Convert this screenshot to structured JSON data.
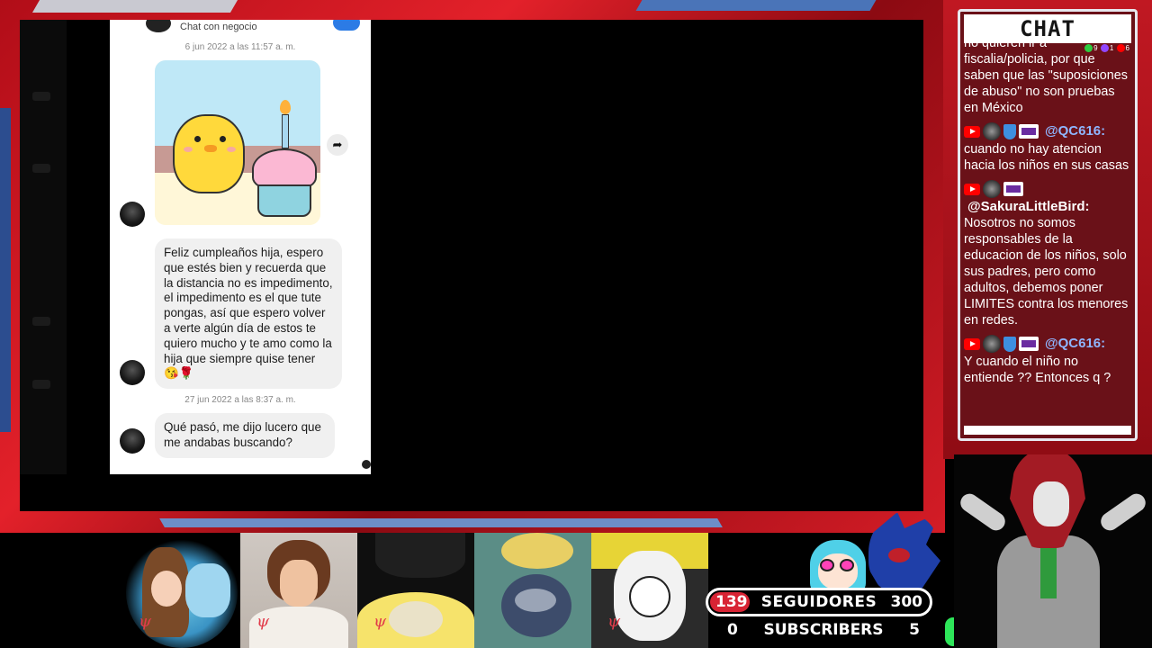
{
  "phone_chat": {
    "header_subtitle": "Chat con negocio",
    "timestamp_1": "6 jun 2022 a las 11:57 a. m.",
    "message_1": "Feliz cumpleaños hija, espero que estés bien y recuerda que la distancia no es impedimento, el impedimento es el que tute pongas, así que espero volver a verte algún día de estos te quiero mucho y te amo como la hija que siempre quise tener 😘🌹",
    "timestamp_2": "27 jun 2022 a las 8:37 a. m.",
    "message_2": "Qué pasó, me dijo lucero que me andabas buscando?",
    "share_icon": "share-arrow-icon"
  },
  "chat_panel": {
    "title": "CHAT",
    "stats": {
      "viewers": "9",
      "twitch": "1",
      "youtube": "6"
    },
    "messages": [
      {
        "author": "",
        "text": "no quieren ir a fiscalia/policia, por que saben que las \"suposiciones de abuso\" no son pruebas en México"
      },
      {
        "author": "@QC616:",
        "text": "cuando no hay atencion hacia los niños en sus casas"
      },
      {
        "author": "@SakuraLittleBird:",
        "text": "Nosotros no somos responsables de la educacion de los niños, solo sus padres, pero como adultos, debemos poner LIMITES contra los menores en redes."
      },
      {
        "author": "@QC616:",
        "text": "Y cuando el niño no entiende ?? Entonces q ?"
      }
    ]
  },
  "counters": {
    "followers_current": "139",
    "followers_label": "SEGUIDORES",
    "followers_goal": "300",
    "subs_current": "0",
    "subs_label": "SUBSCRIBERS",
    "subs_goal": "5"
  },
  "colors": {
    "frame_red": "#d41c26",
    "chat_bg": "#6a1118",
    "author_blue": "#8fb6ff",
    "youtube_red": "#ff0000",
    "progress_green": "#2ee65a"
  }
}
